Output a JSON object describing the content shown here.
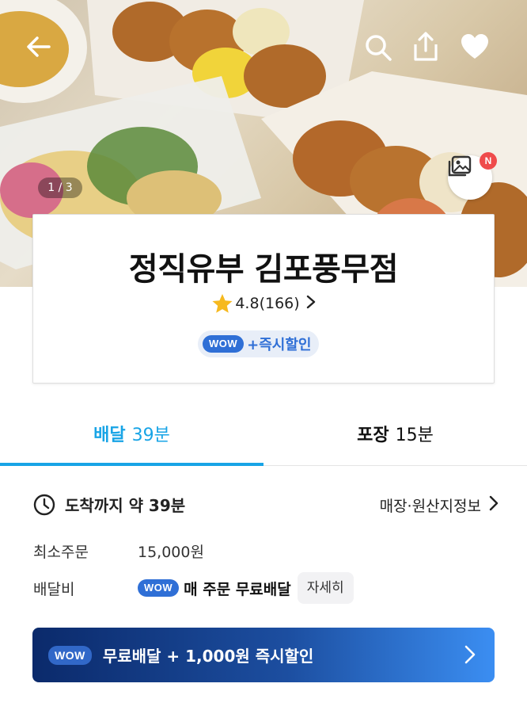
{
  "hero": {
    "photo_counter": "1 / 3",
    "new_badge": "N",
    "icons": [
      "back-icon",
      "search-icon",
      "share-icon",
      "heart-icon",
      "gallery-icon"
    ]
  },
  "store": {
    "name": "정직유부 김포풍무점",
    "rating": "4.8",
    "review_count": "(166)",
    "wow_badge": "WOW",
    "promo": "+즉시할인"
  },
  "tabs": [
    {
      "label": "배달",
      "time": "39분",
      "active": true
    },
    {
      "label": "포장",
      "time": "15분",
      "active": false
    }
  ],
  "delivery": {
    "arrival": "도착까지 약 39분",
    "origin_link": "매장·원산지정보",
    "min_order_label": "최소주문",
    "min_order_value": "15,000원",
    "fee_label": "배달비",
    "fee_wow_badge": "WOW",
    "fee_value": "매 주문 무료배달",
    "detail_button": "자세히"
  },
  "banner": {
    "wow_badge": "WOW",
    "text": "무료배달 + 1,000원 즉시할인"
  },
  "colors": {
    "accent_blue": "#18a4e6",
    "wow_blue": "#2f6fd6",
    "badge_red": "#ef4b4b",
    "banner_start": "#0b2a6b",
    "banner_end": "#3b8ef2"
  }
}
